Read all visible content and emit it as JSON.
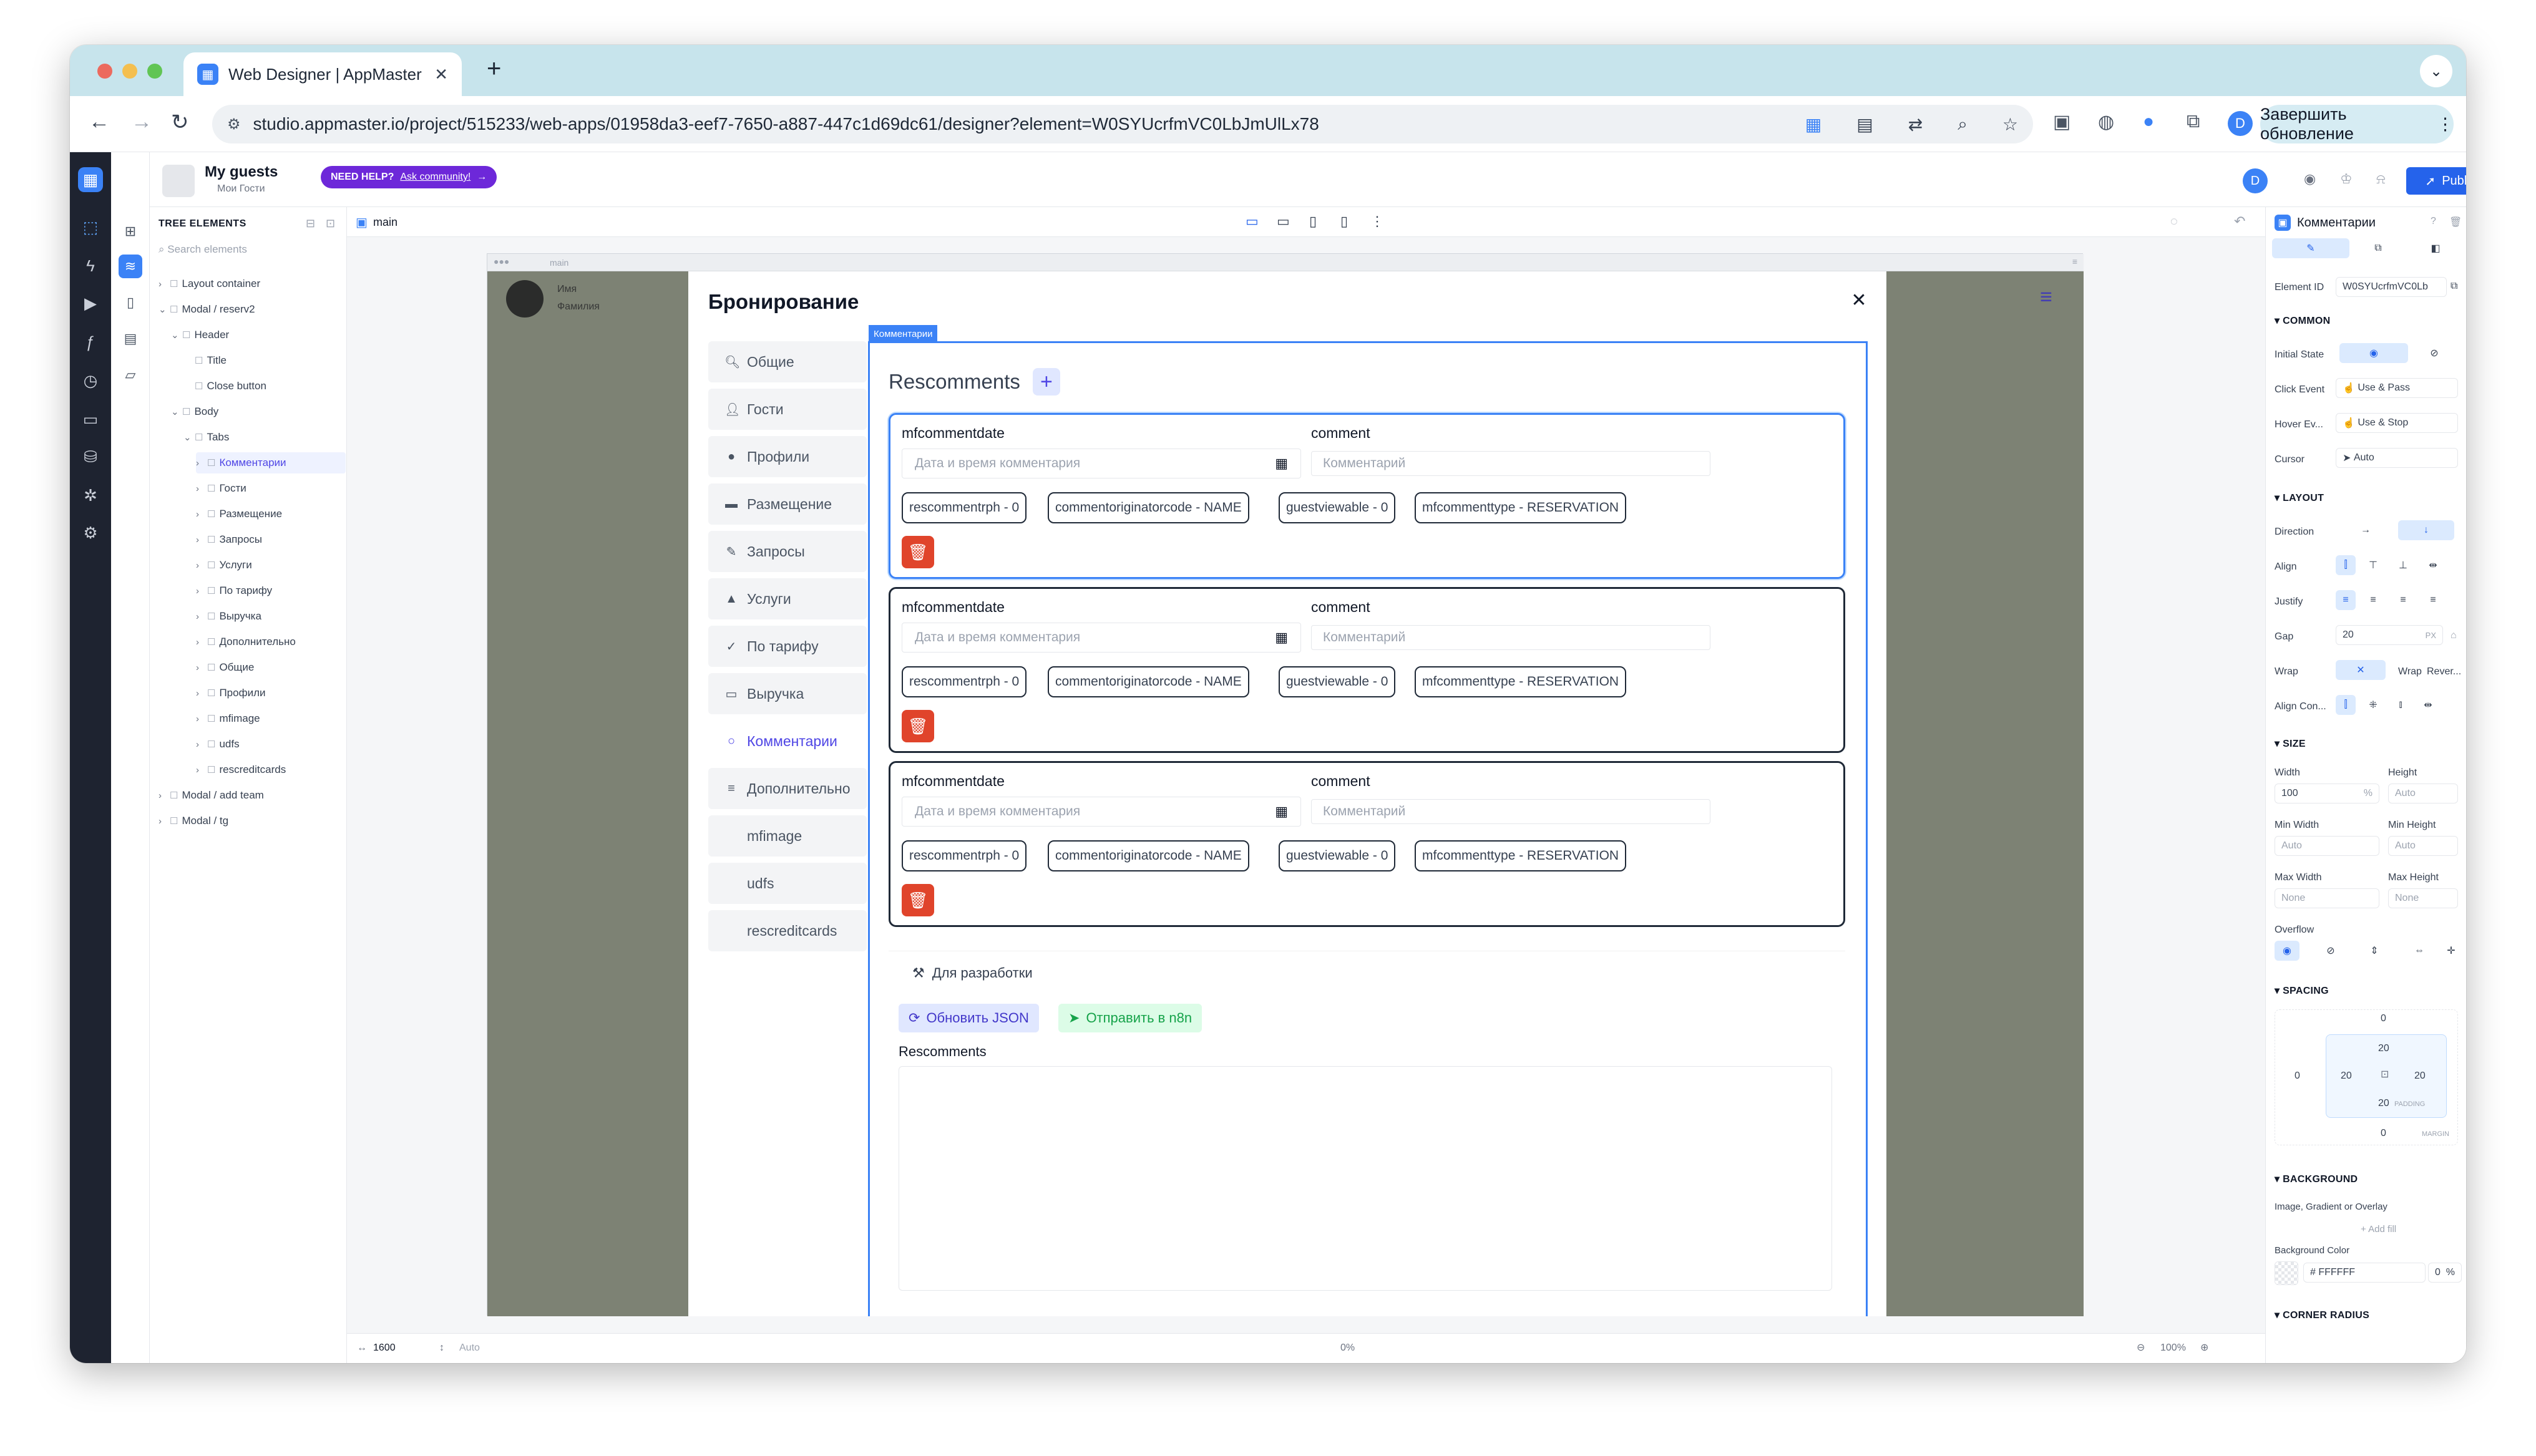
{
  "browser": {
    "tab_title": "Web Designer | AppMaster",
    "url": "studio.appmaster.io/project/515233/web-apps/01958da3-eef7-7650-a887-447c1d69dc61/designer?element=W0SYUcrfmVC0LbJmUlLx78",
    "profile_initial": "D",
    "update_button": "Завершить обновление"
  },
  "app": {
    "project_name": "My guests",
    "project_sub": "Мои Гости",
    "help_label": "NEED HELP?",
    "help_link": "Ask community!",
    "user_initial": "D",
    "publish_label": "Publish"
  },
  "tree": {
    "header": "TREE ELEMENTS",
    "search_placeholder": "Search elements",
    "nodes": [
      {
        "label": "Layout container",
        "depth": 0,
        "caret": "›"
      },
      {
        "label": "Modal / reserv2",
        "depth": 0,
        "caret": "⌄"
      },
      {
        "label": "Header",
        "depth": 1,
        "caret": "⌄"
      },
      {
        "label": "Title",
        "depth": 2,
        "caret": ""
      },
      {
        "label": "Close button",
        "depth": 2,
        "caret": ""
      },
      {
        "label": "Body",
        "depth": 1,
        "caret": "⌄"
      },
      {
        "label": "Tabs",
        "depth": 2,
        "caret": "⌄"
      },
      {
        "label": "Комментарии",
        "depth": 3,
        "caret": "›",
        "selected": true
      },
      {
        "label": "Гости",
        "depth": 3,
        "caret": "›"
      },
      {
        "label": "Размещение",
        "depth": 3,
        "caret": "›"
      },
      {
        "label": "Запросы",
        "depth": 3,
        "caret": "›"
      },
      {
        "label": "Услуги",
        "depth": 3,
        "caret": "›"
      },
      {
        "label": "По тарифу",
        "depth": 3,
        "caret": "›"
      },
      {
        "label": "Выручка",
        "depth": 3,
        "caret": "›"
      },
      {
        "label": "Дополнительно",
        "depth": 3,
        "caret": "›"
      },
      {
        "label": "Общие",
        "depth": 3,
        "caret": "›"
      },
      {
        "label": "Профили",
        "depth": 3,
        "caret": "›"
      },
      {
        "label": "mfimage",
        "depth": 3,
        "caret": "›"
      },
      {
        "label": "udfs",
        "depth": 3,
        "caret": "›"
      },
      {
        "label": "rescreditcards",
        "depth": 3,
        "caret": "›"
      },
      {
        "label": "Modal / add team",
        "depth": 0,
        "caret": "›"
      },
      {
        "label": "Modal / tg",
        "depth": 0,
        "caret": "›"
      }
    ]
  },
  "canvas": {
    "page_tab": "main",
    "frame_url": "main",
    "width_value": "1600",
    "height_value": "Auto",
    "zoom": "100%",
    "offset": "0%"
  },
  "page": {
    "user_name": "Имя",
    "user_surname": "Фамилия"
  },
  "modal": {
    "title": "Бронирование",
    "side_tabs": [
      {
        "label": "Общие",
        "icon": "search-icon",
        "glyph": "🔍︎"
      },
      {
        "label": "Гости",
        "icon": "user-icon",
        "glyph": "👤︎"
      },
      {
        "label": "Профили",
        "icon": "profile-icon",
        "glyph": "●"
      },
      {
        "label": "Размещение",
        "icon": "bed-icon",
        "glyph": "▬"
      },
      {
        "label": "Запросы",
        "icon": "pencil-icon",
        "glyph": "✎"
      },
      {
        "label": "Услуги",
        "icon": "bell-icon",
        "glyph": "▲"
      },
      {
        "label": "По тарифу",
        "icon": "check-icon",
        "glyph": "✓"
      },
      {
        "label": "Выручка",
        "icon": "money-icon",
        "glyph": "▭"
      },
      {
        "label": "Комментарии",
        "icon": "comment-icon",
        "glyph": "○",
        "active": true
      },
      {
        "label": "Дополнительно",
        "icon": "list-icon",
        "glyph": "≡"
      },
      {
        "label": "mfimage",
        "icon": "",
        "glyph": ""
      },
      {
        "label": "udfs",
        "icon": "",
        "glyph": ""
      },
      {
        "label": "rescreditcards",
        "icon": "",
        "glyph": ""
      }
    ],
    "selected_tag": "Комментарии",
    "section_title": "Rescomments",
    "cards": [
      {
        "date_label": "mfcommentdate",
        "date_placeholder": "Дата и время комментария",
        "comment_label": "comment",
        "comment_placeholder": "Комментарий",
        "chips": [
          "rescommentrph - 0",
          "commentoriginatorcode - NAME",
          "guestviewable - 0",
          "mfcommenttype - RESERVATION"
        ]
      },
      {
        "date_label": "mfcommentdate",
        "date_placeholder": "Дата и время комментария",
        "comment_label": "comment",
        "comment_placeholder": "Комментарий",
        "chips": [
          "rescommentrph - 0",
          "commentoriginatorcode - NAME",
          "guestviewable - 0",
          "mfcommenttype - RESERVATION"
        ]
      },
      {
        "date_label": "mfcommentdate",
        "date_placeholder": "Дата и время комментария",
        "comment_label": "comment",
        "comment_placeholder": "Комментарий",
        "chips": [
          "rescommentrph - 0",
          "commentoriginatorcode - NAME",
          "guestviewable - 0",
          "mfcommenttype - RESERVATION"
        ]
      }
    ],
    "dev": {
      "label": "Для разработки",
      "refresh_button": "Обновить JSON",
      "send_button": "Отправить в n8n",
      "textarea_label": "Rescomments"
    }
  },
  "props": {
    "element_name": "Комментарии",
    "element_id_label": "Element ID",
    "element_id_value": "W0SYUcrfmVC0Lb",
    "common": "COMMON",
    "initial_state": "Initial State",
    "click_event": "Click Event",
    "click_value": "Use & Pass",
    "hover_event": "Hover Ev...",
    "hover_value": "Use & Stop",
    "cursor": "Cursor",
    "cursor_value": "Auto",
    "layout": "LAYOUT",
    "direction": "Direction",
    "align": "Align",
    "justify": "Justify",
    "gap": "Gap",
    "gap_value": "20",
    "gap_unit": "PX",
    "wrap": "Wrap",
    "wrap_on": "Wrap",
    "wrap_rev": "Rever...",
    "align_content": "Align Con...",
    "size": "SIZE",
    "width": "Width",
    "width_value": "100",
    "width_unit": "%",
    "height": "Height",
    "height_value": "Auto",
    "min_width": "Min Width",
    "min_width_value": "Auto",
    "min_height": "Min Height",
    "min_height_value": "Auto",
    "max_width": "Max Width",
    "max_width_value": "None",
    "max_height": "Max Height",
    "max_height_value": "None",
    "overflow": "Overflow",
    "spacing": "SPACING",
    "margin_top": "0",
    "margin_left": "0",
    "margin_right": "0",
    "margin_bottom": "0",
    "padding_top": "20",
    "padding_left": "20",
    "padding_right": "20",
    "padding_bottom": "20",
    "padding_label": "PADDING",
    "margin_label": "MARGIN",
    "background": "BACKGROUND",
    "image_fill": "Image, Gradient or Overlay",
    "add_fill": "+ Add fill",
    "bg_color_label": "Background Color",
    "bg_color_value": "FFFFFF",
    "bg_opacity": "0",
    "bg_opacity_unit": "%",
    "corner_radius": "CORNER RADIUS"
  }
}
